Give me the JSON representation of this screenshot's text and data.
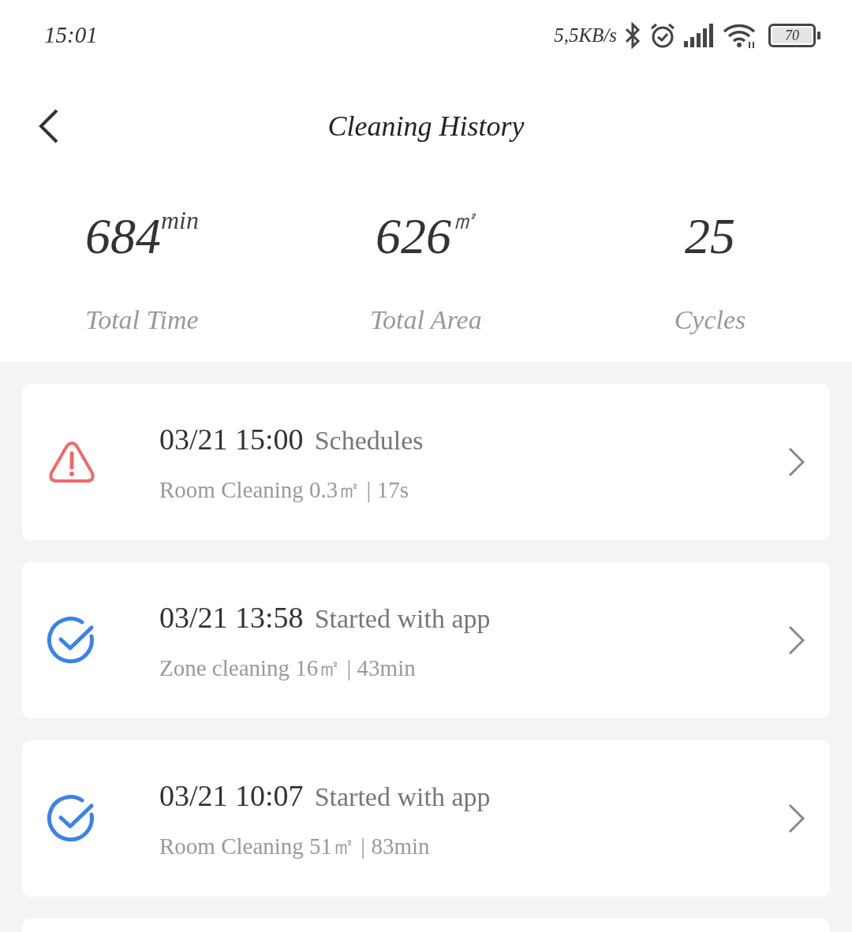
{
  "status_bar": {
    "time": "15:01",
    "speed": "5,5KB/s",
    "battery": "70"
  },
  "header": {
    "title": "Cleaning History"
  },
  "stats": [
    {
      "value": "684",
      "unit": "min",
      "label": "Total Time"
    },
    {
      "value": "626",
      "unit": "㎡",
      "label": "Total Area"
    },
    {
      "value": "25",
      "label": "Cycles"
    }
  ],
  "records": [
    {
      "kind": "error",
      "time": "03/21 15:00",
      "source": "Schedules",
      "detail": "Room Cleaning 0.3㎡ | 17s"
    },
    {
      "kind": "done",
      "time": "03/21 13:58",
      "source": "Started with app",
      "detail": "Zone cleaning 16㎡ | 43min"
    },
    {
      "kind": "done",
      "time": "03/21 10:07",
      "source": "Started with app",
      "detail": "Room Cleaning 51㎡ | 83min"
    }
  ]
}
